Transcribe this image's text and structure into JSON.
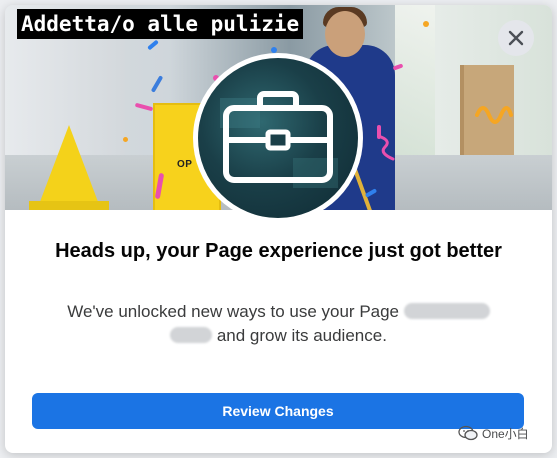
{
  "dialog": {
    "hero": {
      "caption": "Addetta/o alle pulizie",
      "sign_text": "OP",
      "center_icon": "briefcase-icon"
    },
    "close_icon": "close-icon",
    "headline": "Heads up, your Page experience just got better",
    "body_prefix": "We've unlocked new ways to use your Page",
    "body_suffix": "and grow its audience.",
    "primary_button": "Review Changes"
  },
  "watermark": {
    "icon": "wechat-icon",
    "text": "One小白"
  },
  "colors": {
    "primary_button": "#1b74e4",
    "close_button_bg": "#e4e6eb",
    "caption_bg": "#000000"
  }
}
